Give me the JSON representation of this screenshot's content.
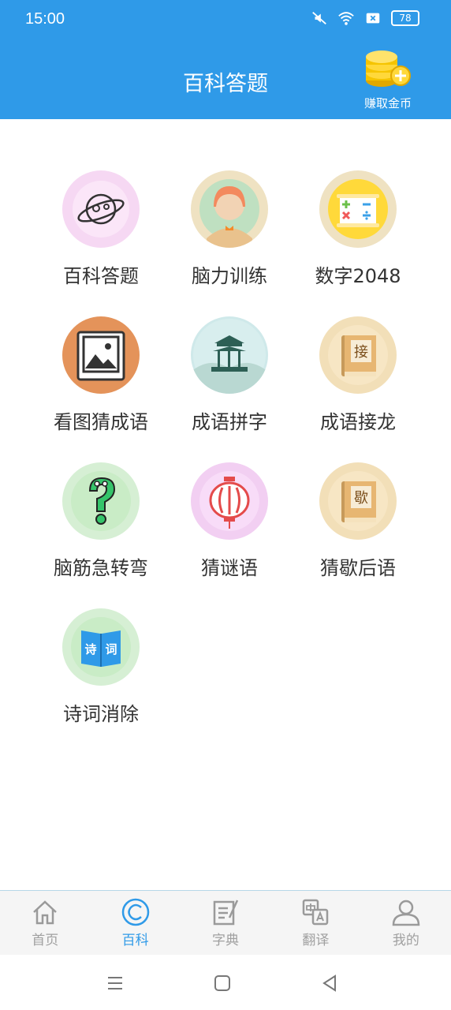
{
  "status_bar": {
    "time": "15:00",
    "battery": "78"
  },
  "header": {
    "title": "百科答题",
    "earn_label": "赚取金币"
  },
  "games": [
    {
      "label": "百科答题",
      "icon": "planet-icon"
    },
    {
      "label": "脑力训练",
      "icon": "girl-avatar-icon"
    },
    {
      "label": "数字2048",
      "icon": "math-board-icon"
    },
    {
      "label": "看图猜成语",
      "icon": "picture-icon"
    },
    {
      "label": "成语拼字",
      "icon": "pavilion-icon"
    },
    {
      "label": "成语接龙",
      "icon": "book-jie-icon"
    },
    {
      "label": "脑筋急转弯",
      "icon": "question-mark-icon"
    },
    {
      "label": "猜谜语",
      "icon": "lantern-icon"
    },
    {
      "label": "猜歇后语",
      "icon": "book-xie-icon"
    },
    {
      "label": "诗词消除",
      "icon": "poetry-book-icon"
    }
  ],
  "book_glyphs": {
    "jie": "接",
    "xie": "歇"
  },
  "poetry_glyphs": {
    "left": "诗",
    "right": "词"
  },
  "bottom_nav": [
    {
      "label": "首页",
      "icon": "home-icon",
      "active": false
    },
    {
      "label": "百科",
      "icon": "encyclopedia-icon",
      "active": true
    },
    {
      "label": "字典",
      "icon": "dictionary-icon",
      "active": false
    },
    {
      "label": "翻译",
      "icon": "translate-icon",
      "active": false
    },
    {
      "label": "我的",
      "icon": "profile-icon",
      "active": false
    }
  ],
  "colors": {
    "primary": "#2f9ae8",
    "inactive": "#a0a0a0"
  }
}
